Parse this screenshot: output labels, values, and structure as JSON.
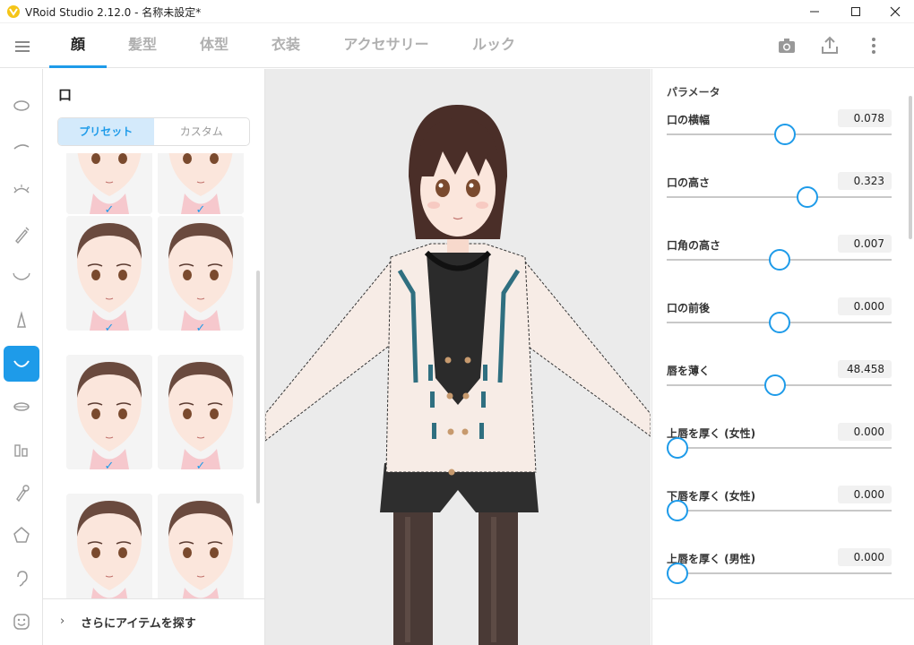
{
  "window": {
    "title": "VRoid Studio 2.12.0 - 名称未設定*",
    "logo_letter": "V"
  },
  "header": {
    "tabs": [
      {
        "label": "顔",
        "active": true
      },
      {
        "label": "髪型",
        "active": false
      },
      {
        "label": "体型",
        "active": false
      },
      {
        "label": "衣装",
        "active": false
      },
      {
        "label": "アクセサリー",
        "active": false
      },
      {
        "label": "ルック",
        "active": false
      }
    ],
    "icons": [
      "menu-icon",
      "camera-icon",
      "export-icon",
      "more-vertical-icon"
    ]
  },
  "rail": {
    "items": [
      {
        "name": "face-outline-icon",
        "active": false
      },
      {
        "name": "eyebrow-icon",
        "active": false
      },
      {
        "name": "eyelash-icon",
        "active": false
      },
      {
        "name": "eyeliner-icon",
        "active": false
      },
      {
        "name": "eye-icon",
        "active": false
      },
      {
        "name": "nose-icon",
        "active": false
      },
      {
        "name": "mouth-icon",
        "active": true
      },
      {
        "name": "lips-icon",
        "active": false
      },
      {
        "name": "teeth-icon",
        "active": false
      },
      {
        "name": "makeup-brush-icon",
        "active": false
      },
      {
        "name": "face-shape-icon",
        "active": false
      },
      {
        "name": "ear-icon",
        "active": false
      },
      {
        "name": "expression-icon",
        "active": false
      }
    ],
    "accent": "#1e9be9"
  },
  "panel": {
    "title": "口",
    "segments": [
      "プリセット",
      "カスタム"
    ],
    "active_segment": "プリセット",
    "check_mark": "✓",
    "more_chevron": "›",
    "more_label": "さらにアイテムを探す"
  },
  "params": {
    "title": "パラメータ",
    "items": [
      {
        "label": "口の横幅",
        "value": "0.078",
        "level": 0.53
      },
      {
        "label": "口の高さ",
        "value": "0.323",
        "level": 0.64
      },
      {
        "label": "口角の高さ",
        "value": "0.007",
        "level": 0.5
      },
      {
        "label": "口の前後",
        "value": "0.000",
        "level": 0.5
      },
      {
        "label": "唇を薄く",
        "value": "48.458",
        "level": 0.48
      },
      {
        "label": "上唇を厚く (女性)",
        "value": "0.000",
        "level": 0.0
      },
      {
        "label": "下唇を厚く (女性)",
        "value": "0.000",
        "level": 0.0
      },
      {
        "label": "上唇を厚く (男性)",
        "value": "0.000",
        "level": 0.0
      }
    ]
  },
  "colors": {
    "accent": "#1e9be9",
    "viewport_bg": "#ebebeb",
    "cardigan": "#f7ece6",
    "ribbon": "#2f6f80",
    "hair": "#4a2e28"
  }
}
